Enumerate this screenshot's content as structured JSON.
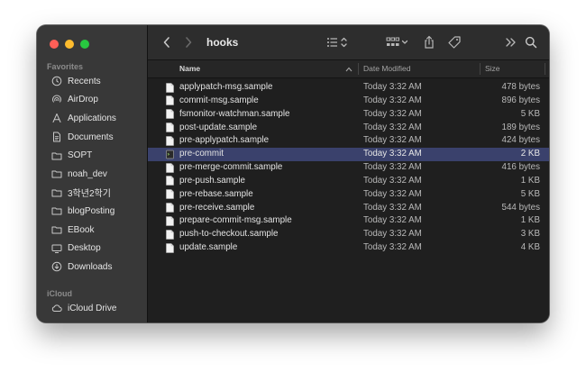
{
  "window": {
    "title": "hooks"
  },
  "sidebar": {
    "favorites_label": "Favorites",
    "items": [
      {
        "label": "Recents",
        "icon": "clock-icon"
      },
      {
        "label": "AirDrop",
        "icon": "airdrop-icon"
      },
      {
        "label": "Applications",
        "icon": "applications-icon"
      },
      {
        "label": "Documents",
        "icon": "document-icon"
      },
      {
        "label": "SOPT",
        "icon": "folder-icon"
      },
      {
        "label": "noah_dev",
        "icon": "folder-icon"
      },
      {
        "label": "3학년2학기",
        "icon": "folder-icon"
      },
      {
        "label": "blogPosting",
        "icon": "folder-icon"
      },
      {
        "label": "EBook",
        "icon": "folder-icon"
      },
      {
        "label": "Desktop",
        "icon": "desktop-icon"
      },
      {
        "label": "Downloads",
        "icon": "downloads-icon"
      }
    ],
    "icloud_label": "iCloud",
    "icloud_items": [
      {
        "label": "iCloud Drive",
        "icon": "icloud-icon"
      }
    ]
  },
  "columns": {
    "name": "Name",
    "date": "Date Modified",
    "size": "Size"
  },
  "files": [
    {
      "name": "applypatch-msg.sample",
      "date": "Today 3:32 AM",
      "size": "478 bytes",
      "selected": false
    },
    {
      "name": "commit-msg.sample",
      "date": "Today 3:32 AM",
      "size": "896 bytes",
      "selected": false
    },
    {
      "name": "fsmonitor-watchman.sample",
      "date": "Today 3:32 AM",
      "size": "5 KB",
      "selected": false
    },
    {
      "name": "post-update.sample",
      "date": "Today 3:32 AM",
      "size": "189 bytes",
      "selected": false
    },
    {
      "name": "pre-applypatch.sample",
      "date": "Today 3:32 AM",
      "size": "424 bytes",
      "selected": false
    },
    {
      "name": "pre-commit",
      "date": "Today 3:32 AM",
      "size": "2 KB",
      "selected": true
    },
    {
      "name": "pre-merge-commit.sample",
      "date": "Today 3:32 AM",
      "size": "416 bytes",
      "selected": false
    },
    {
      "name": "pre-push.sample",
      "date": "Today 3:32 AM",
      "size": "1 KB",
      "selected": false
    },
    {
      "name": "pre-rebase.sample",
      "date": "Today 3:32 AM",
      "size": "5 KB",
      "selected": false
    },
    {
      "name": "pre-receive.sample",
      "date": "Today 3:32 AM",
      "size": "544 bytes",
      "selected": false
    },
    {
      "name": "prepare-commit-msg.sample",
      "date": "Today 3:32 AM",
      "size": "1 KB",
      "selected": false
    },
    {
      "name": "push-to-checkout.sample",
      "date": "Today 3:32 AM",
      "size": "3 KB",
      "selected": false
    },
    {
      "name": "update.sample",
      "date": "Today 3:32 AM",
      "size": "4 KB",
      "selected": false
    }
  ],
  "colors": {
    "selection": "#3a416c",
    "accent": "#0a84ff"
  }
}
